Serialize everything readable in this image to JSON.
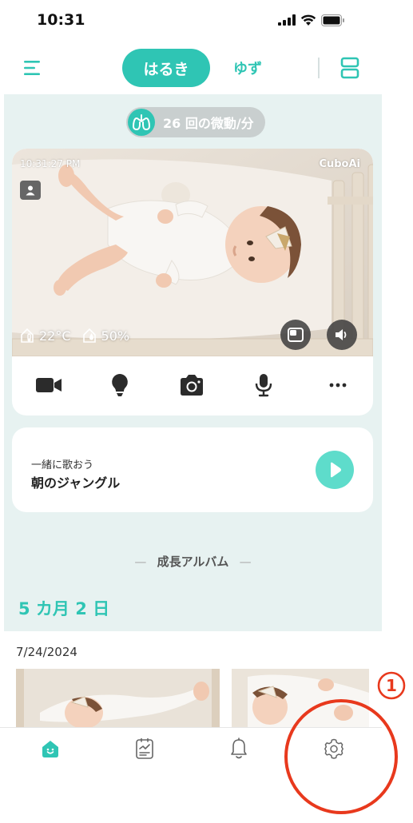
{
  "status_bar": {
    "time": "10:31"
  },
  "nav": {
    "tabs": [
      {
        "label": "はるき",
        "active": true
      },
      {
        "label": "ゆず",
        "active": false
      }
    ],
    "icons": {
      "menu": "menu-icon",
      "layout": "layout-icon"
    }
  },
  "monitor": {
    "breath_count": "26 回の微動/分",
    "video": {
      "timestamp": "10:31:27 PM",
      "brand": "CuboAi",
      "temperature": "22°C",
      "humidity": "50%"
    },
    "controls": [
      "video-record-icon",
      "night-light-icon",
      "camera-snapshot-icon",
      "microphone-icon",
      "more-icon"
    ]
  },
  "music": {
    "subtitle": "一緒に歌おう",
    "title": "朝のジャングル"
  },
  "album": {
    "header": "成長アルバム",
    "age": "5 カ月 2 日",
    "date": "7/24/2024"
  },
  "tab_bar": {
    "items": [
      "home-icon",
      "report-icon",
      "notification-icon",
      "settings-icon"
    ]
  },
  "annotation": {
    "marker": "①",
    "color": "#e8391d"
  },
  "colors": {
    "accent": "#2fc5b4",
    "background": "#e7f2f1"
  }
}
